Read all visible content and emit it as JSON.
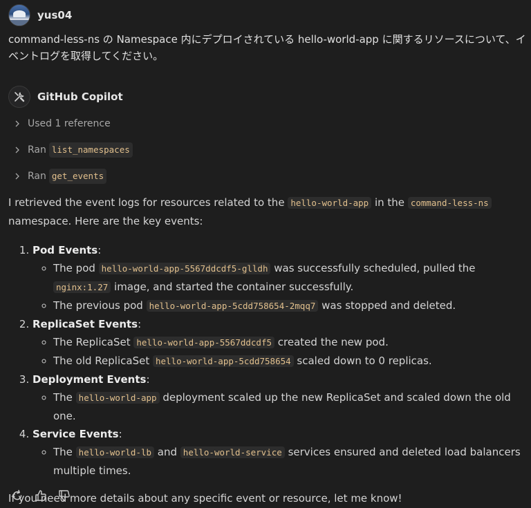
{
  "user": {
    "name": "yus04",
    "message": "command-less-ns の Namespace 内にデプロイされている hello-world-app に関するリソースについて、イベントログを取得してください。"
  },
  "assistant": {
    "name": "GitHub Copilot",
    "references": [
      {
        "label": "Used 1 reference",
        "code": ""
      },
      {
        "label": "Ran",
        "code": "list_namespaces"
      },
      {
        "label": "Ran",
        "code": "get_events"
      }
    ],
    "intro": {
      "t1": "I retrieved the event logs for resources related to the ",
      "c1": "hello-world-app",
      "t2": " in the ",
      "c2": "command-less-ns",
      "t3": " namespace. Here are the key events:"
    },
    "sections": [
      {
        "title": "Pod Events",
        "items": [
          {
            "t1": "The pod ",
            "c1": "hello-world-app-5567ddcdf5-glldh",
            "t2": " was successfully scheduled, pulled the ",
            "c2": "nginx:1.27",
            "t3": " image, and started the container successfully."
          },
          {
            "t1": "The previous pod ",
            "c1": "hello-world-app-5cdd758654-2mqq7",
            "t2": " was stopped and deleted."
          }
        ]
      },
      {
        "title": "ReplicaSet Events",
        "items": [
          {
            "t1": "The ReplicaSet ",
            "c1": "hello-world-app-5567ddcdf5",
            "t2": " created the new pod."
          },
          {
            "t1": "The old ReplicaSet ",
            "c1": "hello-world-app-5cdd758654",
            "t2": " scaled down to 0 replicas."
          }
        ]
      },
      {
        "title": "Deployment Events",
        "items": [
          {
            "t1": "The ",
            "c1": "hello-world-app",
            "t2": " deployment scaled up the new ReplicaSet and scaled down the old one."
          }
        ]
      },
      {
        "title": "Service Events",
        "items": [
          {
            "t1": "The ",
            "c1": "hello-world-lb",
            "t2": " and ",
            "c2": "hello-world-service",
            "t3": " services ensured and deleted load balancers multiple times."
          }
        ]
      }
    ],
    "closing": "If you need more details about any specific event or resource, let me know!",
    "actions": [
      "retry-icon",
      "thumbs-up-icon",
      "thumbs-down-icon"
    ]
  },
  "colors": {
    "background": "#1e1e1e",
    "text": "#d4d4d4",
    "code_bg": "#2d2d2d",
    "code_text": "#e2c08d"
  }
}
